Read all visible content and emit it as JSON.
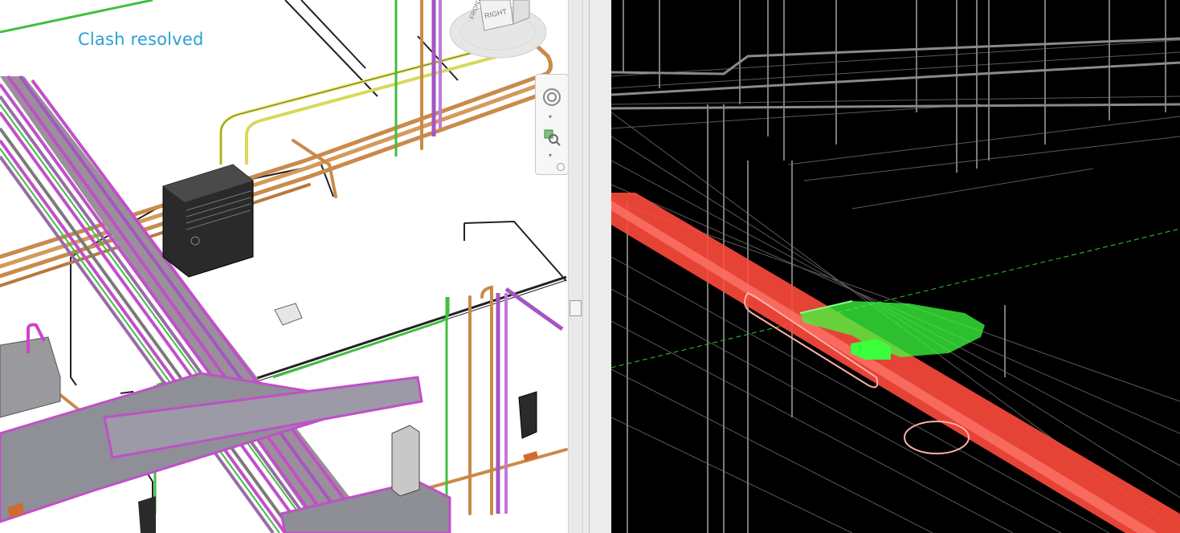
{
  "left_view": {
    "caption": "Clash resolved",
    "viewcube": {
      "face_label": "RIGHT",
      "top_label": "FRONT"
    },
    "navbar": {
      "tools": [
        "steering-wheel-icon",
        "zoom-icon",
        "navbar-options-icon"
      ]
    }
  },
  "right_view": {
    "highlight_colors": {
      "clash_pipe": "#ff4a3d",
      "clash_element": "#3cff3c"
    }
  },
  "colors": {
    "pipe_orange": "#c88a4a",
    "pipe_purple": "#b266c8",
    "pipe_magenta": "#d040d0",
    "pipe_green": "#3cc83c",
    "pipe_yellow": "#e0e060",
    "caption_blue": "#2aa0d8"
  }
}
